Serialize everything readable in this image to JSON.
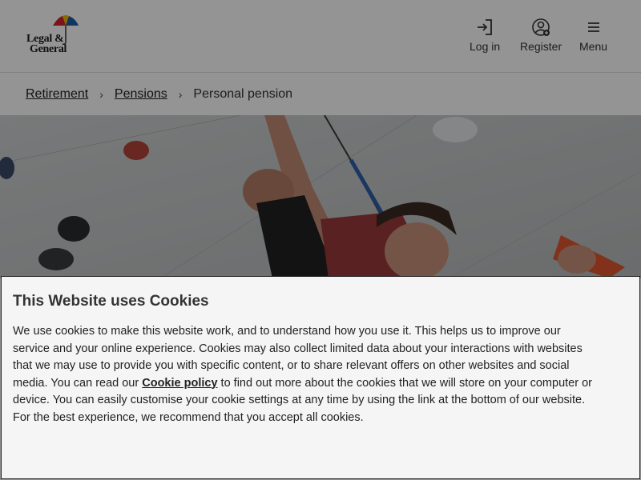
{
  "header": {
    "logo_line1": "Legal &",
    "logo_line2": "General",
    "login_label": "Log in",
    "register_label": "Register",
    "menu_label": "Menu"
  },
  "breadcrumb": {
    "items": [
      "Retirement",
      "Pensions"
    ],
    "current": "Personal pension",
    "separator": "›"
  },
  "hero": {
    "description_icon": "climber-photo"
  },
  "cookie_banner": {
    "title": "This Website uses Cookies",
    "text_before_link": "We use cookies to make this website work, and to understand how you use it. This helps us to improve our service and your online experience. Cookies may also collect limited data about your interactions with websites that we may use to provide you with specific content, or to share relevant offers on other websites and social media. You can read our ",
    "link_text": "Cookie policy",
    "text_after_link": " to find out more about the cookies that we will store on your computer or device. You can easily customise your cookie settings at any time by using the link at the bottom of our website. For the best experience, we recommend that you accept all cookies."
  },
  "colors": {
    "umbrella_green": "#2e8b3a",
    "umbrella_red": "#d2232a",
    "umbrella_blue": "#1f5aa6",
    "umbrella_yellow": "#f2b705",
    "overlay": "rgba(0,0,0,0.42)"
  }
}
